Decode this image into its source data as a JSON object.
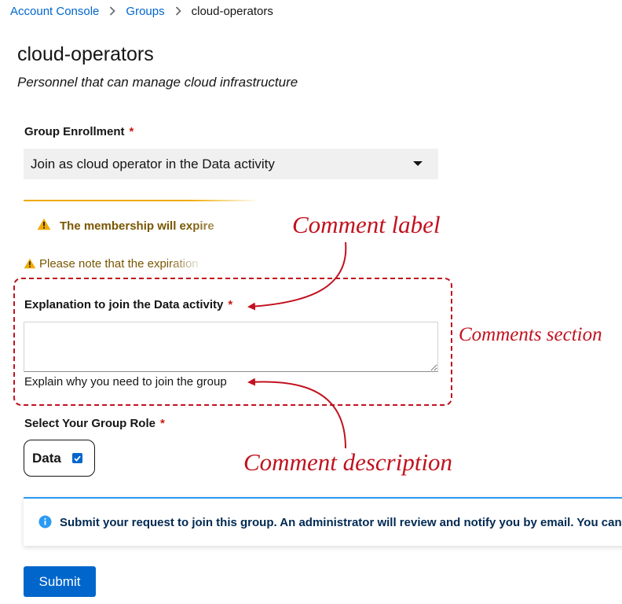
{
  "breadcrumb": {
    "items": [
      "Account Console",
      "Groups"
    ],
    "current": "cloud-operators"
  },
  "page": {
    "title": "cloud-operators",
    "subtitle": "Personnel that can manage cloud infrastructure"
  },
  "enrollment": {
    "label": "Group Enrollment",
    "required_marker": "*",
    "selected": "Join as cloud operator in the Data activity"
  },
  "warning_alert": {
    "text": "The membership will expire"
  },
  "expiration_note": {
    "text": "Please note that the expiration"
  },
  "comment": {
    "label": "Explanation to join the Data activity",
    "required_marker": "*",
    "value": "",
    "help": "Explain why you need to join the group"
  },
  "role": {
    "label": "Select Your Group Role",
    "required_marker": "*",
    "option": "Data",
    "checked": true
  },
  "info_alert": {
    "text": "Submit your request to join this group. An administrator will review and notify you by email. You can track"
  },
  "submit": {
    "label": "Submit"
  },
  "annotations": {
    "comment_label": "Comment label",
    "comments_section": "Comments section",
    "comment_description": "Comment description"
  },
  "colors": {
    "link": "#0066cc",
    "required": "#c9190b",
    "warning": "#f0ab00",
    "info": "#2b9af3",
    "annotation": "#c1121f",
    "primary_button": "#0066cc"
  },
  "icons": [
    "chevron-right-icon",
    "caret-down-icon",
    "warning-triangle-icon",
    "info-circle-icon",
    "checkmark-icon"
  ]
}
